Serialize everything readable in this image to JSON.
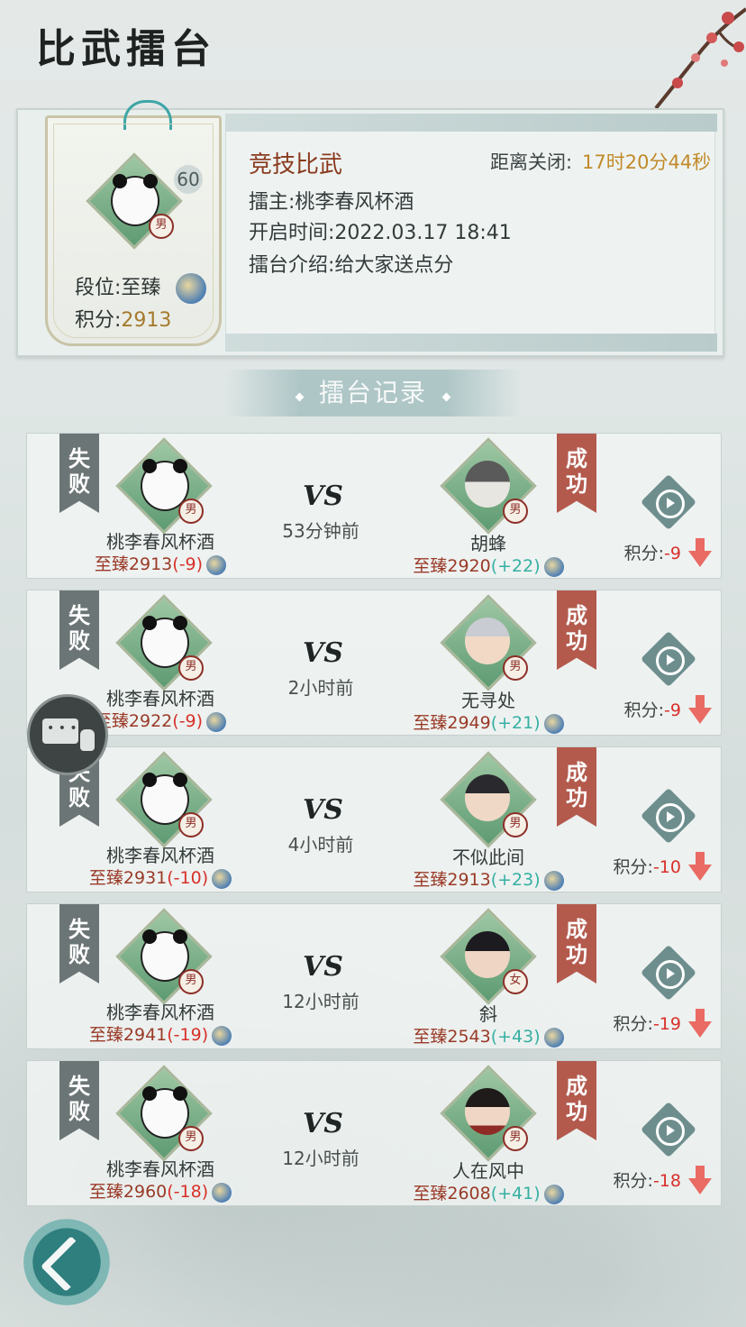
{
  "page": {
    "title": "比武擂台"
  },
  "player": {
    "level": "60",
    "gender": "男",
    "rank_label": "段位:",
    "rank_value": "至臻",
    "score_label": "积分:",
    "score_value": "2913"
  },
  "arena": {
    "name": "竞技比武",
    "close_label": "距离关闭:",
    "close_time": "17时20分44秒",
    "host": "擂主:桃李春风杯酒",
    "open_time": "开启时间:2022.03.17  18:41",
    "intro": "擂台介绍:给大家送点分"
  },
  "section": {
    "title": "擂台记录"
  },
  "labels": {
    "lose": "失败",
    "win": "成功",
    "vs": "VS",
    "points": "积分:"
  },
  "records": [
    {
      "left": {
        "name": "桃李春风杯酒",
        "gender": "男",
        "rank": "至臻2913",
        "delta": "(-9)"
      },
      "time": "53分钟前",
      "right": {
        "name": "胡蜂",
        "gender": "男",
        "rank": "至臻2920",
        "delta": "(+22)"
      },
      "points": "-9"
    },
    {
      "left": {
        "name": "桃李春风杯酒",
        "gender": "男",
        "rank": "至臻2922",
        "delta": "(-9)"
      },
      "time": "2小时前",
      "right": {
        "name": "无寻处",
        "gender": "男",
        "rank": "至臻2949",
        "delta": "(+21)"
      },
      "points": "-9"
    },
    {
      "left": {
        "name": "桃李春风杯酒",
        "gender": "男",
        "rank": "至臻2931",
        "delta": "(-10)"
      },
      "time": "4小时前",
      "right": {
        "name": "不似此间",
        "gender": "男",
        "rank": "至臻2913",
        "delta": "(+23)"
      },
      "points": "-10"
    },
    {
      "left": {
        "name": "桃李春风杯酒",
        "gender": "男",
        "rank": "至臻2941",
        "delta": "(-19)"
      },
      "time": "12小时前",
      "right": {
        "name": "斜",
        "gender": "女",
        "rank": "至臻2543",
        "delta": "(+43)"
      },
      "points": "-19"
    },
    {
      "left": {
        "name": "桃李春风杯酒",
        "gender": "男",
        "rank": "至臻2960",
        "delta": "(-18)"
      },
      "time": "12小时前",
      "right": {
        "name": "人在风中",
        "gender": "男",
        "rank": "至臻2608",
        "delta": "(+41)"
      },
      "points": "-18"
    }
  ]
}
